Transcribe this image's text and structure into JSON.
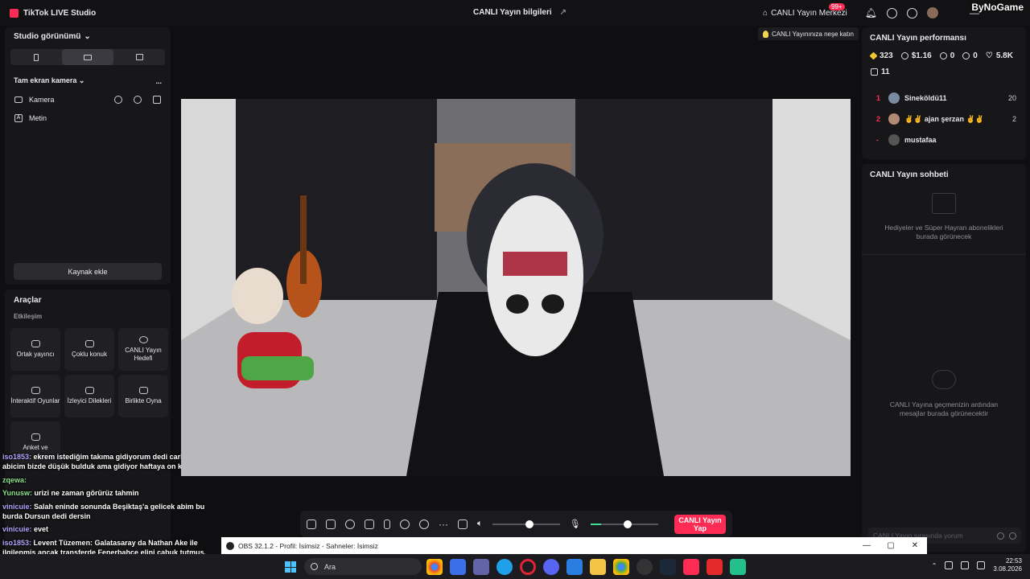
{
  "titlebar": {
    "app_title": "TikTok LIVE Studio",
    "center_title": "CANLI Yayın bilgileri",
    "live_center": "CANLI Yayın Merkezi",
    "notif_badge": "99+",
    "watermark": "ByNoGame"
  },
  "left_panel": {
    "studio_view": "Studio görünümü",
    "scene_name": "Tam ekran kamera",
    "more": "...",
    "sources": [
      {
        "label": "Kamera"
      },
      {
        "label": "Metin"
      }
    ],
    "add_source": "Kaynak ekle"
  },
  "tools": {
    "title": "Araçlar",
    "section": "Etkileşim",
    "items": [
      {
        "label": "Ortak yayıncı"
      },
      {
        "label": "Çoklu konuk"
      },
      {
        "label": "CANLI Yayın Hedefi"
      },
      {
        "label": "İnteraktif Oyunlar"
      },
      {
        "label": "İzleyici Dilekleri"
      },
      {
        "label": "Birlikte Oyna"
      },
      {
        "label": "Anket ve"
      }
    ]
  },
  "chat_overlay": [
    {
      "user": "iso1853:",
      "text": "ekrem istediğim takıma gidiyorum dedi carlos amk abicim bizde düşük bulduk ama gidiyor haftaya on kişi birden",
      "color": "purple"
    },
    {
      "user": "zqewa:",
      "text": "",
      "color": "green"
    },
    {
      "user": "Yunusw:",
      "text": "urizi ne zaman görürüz tahmin",
      "color": "green"
    },
    {
      "user": "vinicuie:",
      "text": "Salah eninde sonunda Beşiktaş'a gelicek abim bu burda Dursun dedi dersin",
      "color": "purple"
    },
    {
      "user": "vinicuie:",
      "text": "evet",
      "color": "purple"
    },
    {
      "user": "iso1853:",
      "text": "Levent Tüzemen: Galatasaray da Nathan Ake ile ilgilenmiş ancak transferde Fenerbahçe elini çabuk tutmuş. Bana böyle bir bilgi geldi. @bakemask",
      "color": "purple"
    }
  ],
  "stage": {
    "top_hint": "CANLI Yayınınıza neşe katın"
  },
  "controls": {
    "volume_level": 0.55,
    "mic_level": 0.55,
    "go_live_label": "CANLI Yayın Yap"
  },
  "performance": {
    "title": "CANLI Yayın performansı",
    "diamonds": "323",
    "earnings": "$1.16",
    "viewers": "0",
    "new_followers": "0",
    "likes": "5.8K",
    "gifts": "11",
    "ranking": [
      {
        "rank": "1",
        "name": "Sineköldü11",
        "score": "20"
      },
      {
        "rank": "2",
        "name": "✌️✌️ ajan şerzan ✌️✌️",
        "score": "2"
      },
      {
        "rank": "-",
        "name": "mustafaa",
        "score": ""
      }
    ]
  },
  "chat_panel": {
    "title": "CANLI Yayın sohbeti",
    "gifts_empty": "Hediyeler ve Süper Hayran abonelikleri burada görünecek",
    "chat_empty": "CANLI Yayına geçmenizin ardından mesajlar burada görünecektir",
    "input_placeholder": "CANLI Yayın sırasında yorum"
  },
  "obs": {
    "title": "OBS 32.1.2 - Profil: İsimsiz - Sahneler: İsimsiz"
  },
  "taskbar": {
    "search": "Ara",
    "time": "22:53",
    "date": "3.08.2026"
  },
  "colors": {
    "accent": "#fe2c55",
    "bg": "#0f0f11",
    "panel": "#17171a"
  }
}
